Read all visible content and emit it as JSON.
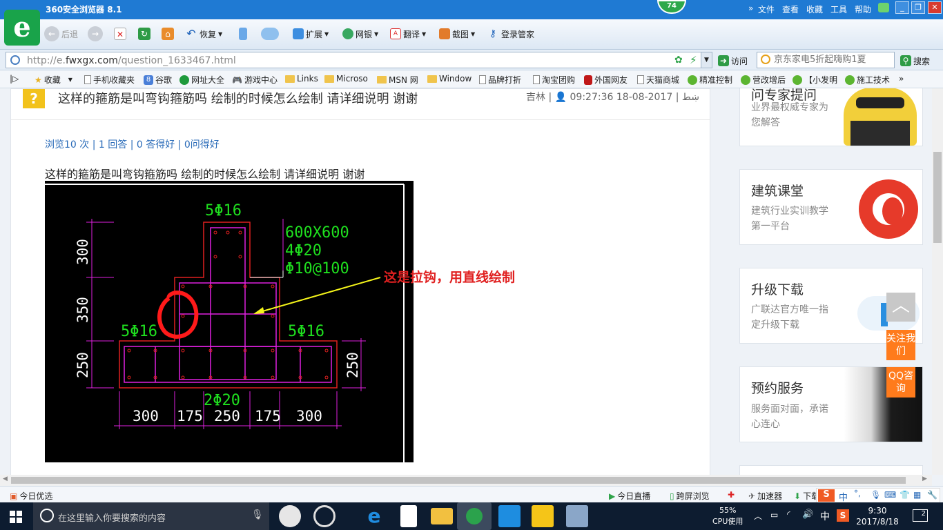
{
  "window": {
    "title": "360安全浏览器 8.1",
    "badge": "74",
    "menu": [
      "文件",
      "查看",
      "收藏",
      "工具",
      "帮助"
    ]
  },
  "toolbar": {
    "back": "后退",
    "restore": "恢复",
    "extend": "扩展",
    "bank": "网银",
    "translate": "翻译",
    "screenshot": "截图",
    "login": "登录管家"
  },
  "address": {
    "url_prefix": "http://e.",
    "url_domain": "fwxgx.com",
    "url_path": "/question_1633467.html",
    "go": "访问",
    "search_placeholder": "京东家电5折起嗨购1夏",
    "search_button": "搜索"
  },
  "bookmarks": [
    "收藏",
    "手机收藏夹",
    "谷歌",
    "网址大全",
    "游戏中心",
    "Links",
    "Microso",
    "MSN 网",
    "Window",
    "品牌打折",
    "淘宝团购",
    "外国网友",
    "天猫商城",
    "精准控制",
    "营改增后",
    "【小发明",
    "施工技术"
  ],
  "question": {
    "icon": "?",
    "title": "这样的箍筋是叫弯钩箍筋吗  绘制的时候怎么绘制  请详细说明  谢谢",
    "author": "吉林",
    "user": "ښط",
    "time": "2017-08-18 09:27:36",
    "stats": "浏览10 次 | 1 回答 | 0 答得好 | 0问得好",
    "body": "这样的箍筋是叫弯钩箍筋吗  绘制的时候怎么绘制  请详细说明  谢谢"
  },
  "drawing": {
    "top_rebar": "5Φ16",
    "left_rebar": "5Φ16",
    "right_rebar": "5Φ16",
    "bottom_rebar": "2Φ20",
    "section": "600X600",
    "corner_bars": "4Φ20",
    "stirrup": "Φ10@100",
    "dim_300": "300",
    "dim_350": "350",
    "dim_250_left": "250",
    "dim_250_right": "250",
    "bottom_dims": [
      "300",
      "175",
      "250",
      "175",
      "300"
    ],
    "annotation": "这是拉钩，用直线绘制"
  },
  "sidebar": [
    {
      "title": "问专家提问",
      "sub": "业界最权威专家为您解答"
    },
    {
      "title": "建筑课堂",
      "sub": "建筑行业实训教学第一平台"
    },
    {
      "title": "升级下载",
      "sub": "广联达官方唯一指定升级下载"
    },
    {
      "title": "预约服务",
      "sub": "服务面对面，承诺心连心"
    }
  ],
  "float": {
    "follow": "关注我们",
    "qq": "QQ咨询"
  },
  "statusbar": {
    "left": "今日优选",
    "live": "今日直播",
    "cross": "跨屏浏览",
    "accelerator": "加速器",
    "download": "下载",
    "ime": "中"
  },
  "taskbar": {
    "search_placeholder": "在这里输入你要搜索的内容",
    "cpu_percent": "55%",
    "cpu_label": "CPU使用",
    "ime": "中",
    "time": "9:30",
    "date": "2017/8/18",
    "notifications": "2"
  },
  "colors": {
    "titlebar": "#1f7ad3",
    "logo": "#19a34a",
    "cad_green": "#1fe01f",
    "cad_magenta": "#e020e0",
    "cad_red": "#e02020",
    "annotation": "#e02020",
    "float": "#ff7b1c"
  }
}
